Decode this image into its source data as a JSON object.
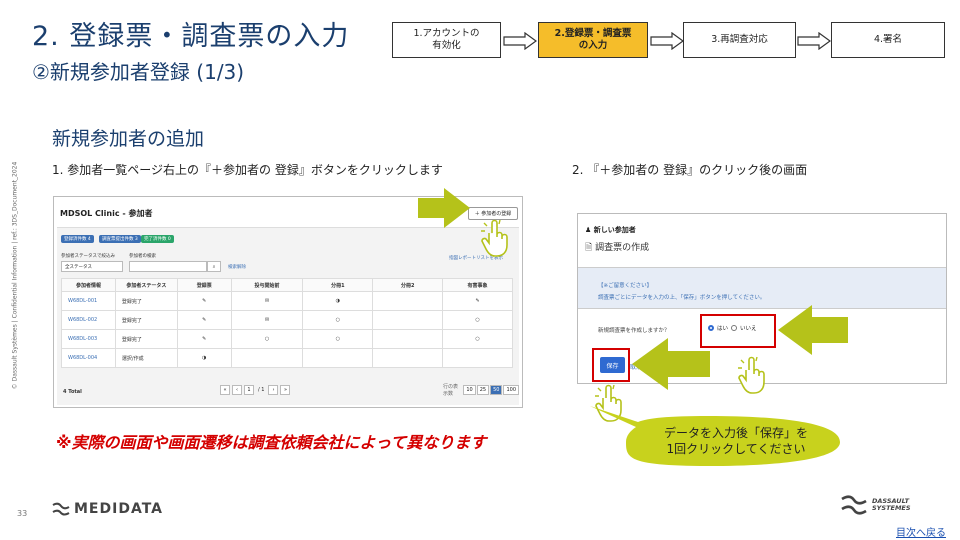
{
  "header": {
    "title": "2. 登録票・調査票の入力",
    "subtitle": "②新規参加者登録 (1/3)"
  },
  "steps": [
    {
      "label": "1.アカウントの\n有効化",
      "active": false
    },
    {
      "label": "2.登録票・調査票\nの入力",
      "active": true
    },
    {
      "label": "3.再調査対応",
      "active": false
    },
    {
      "label": "4.署名",
      "active": false
    }
  ],
  "section_title": "新規参加者の追加",
  "instruction_1": "1.   参加者一覧ページ右上の『＋参加者の 登録』ボタンをクリックします",
  "instruction_2": "2.   『＋参加者の 登録』のクリック後の画面",
  "vertical_text": "© Dassault Systèmes | Confidential Information | ref.: 3DS_Document_2024",
  "left_screen": {
    "header": "MDSOL Clinic - 参加者",
    "add_button": "＋ 参加者の登録",
    "badges": [
      {
        "label": "登録済件数 4",
        "color": "#3b6fb4"
      },
      {
        "label": "調査票提出件数 3",
        "color": "#3b6fb4"
      },
      {
        "label": "完了済件数 0",
        "color": "#2aa56a"
      }
    ],
    "filter_status_label": "参加者ステータスで絞込み",
    "filter_status_value": "全ステータス",
    "search_label": "参加者の検索",
    "search_link": "検索解除",
    "report_link": "指図レポートリストを表示",
    "columns": [
      "参加者情報",
      "参加者ステータス",
      "登録票",
      "投与開始前",
      "分冊1",
      "分冊2",
      "有害事象"
    ],
    "rows": [
      {
        "id": "W68DL-001",
        "status": "登録完了",
        "cells": [
          "✎",
          "✉",
          "◑",
          "",
          "✎"
        ]
      },
      {
        "id": "W68DL-002",
        "status": "登録完了",
        "cells": [
          "✎",
          "✉",
          "○",
          "",
          "○"
        ]
      },
      {
        "id": "W68DL-003",
        "status": "登録完了",
        "cells": [
          "✎",
          "○",
          "○",
          "",
          "○"
        ]
      },
      {
        "id": "W68DL-004",
        "status": "選択/作成",
        "cells": [
          "◑",
          "",
          "",
          "",
          ""
        ]
      }
    ],
    "total": "4 Total",
    "pager": [
      "«",
      "‹",
      "1",
      "/ 1",
      "›",
      "»"
    ],
    "page_size_label": "行の表示数",
    "page_sizes": [
      "10",
      "25",
      "50",
      "100"
    ],
    "page_size_selected": "50"
  },
  "right_screen": {
    "header_small": "新しい参加者",
    "header_title": "調査票の作成",
    "notice_title": "【※ご留意ください】",
    "notice_body": "調査票ごとにデータを入力の上、「保存」ボタンを押してください。",
    "question": "新規調査票を作成しますか？",
    "option_yes": "はい",
    "option_no": "いいえ",
    "save_label": "保存",
    "cancel_label": "取消"
  },
  "note": "※実際の画面や画面遷移は調査依頼会社によって異なります",
  "callout": "データを入力後「保存」を\n1回クリックしてください",
  "footer": {
    "page_number": "33",
    "medidata_logo": "MEDIDATA",
    "ds_logo_line1": "DASSAULT",
    "ds_logo_line2": "SYSTEMES",
    "toc_link": "目次へ戻る"
  },
  "colors": {
    "title": "#1b3f6e",
    "active_step": "#f5bd2a",
    "arrow_green": "#b5c21a",
    "red_highlight": "#d40000",
    "link_blue": "#1a4fb0"
  }
}
